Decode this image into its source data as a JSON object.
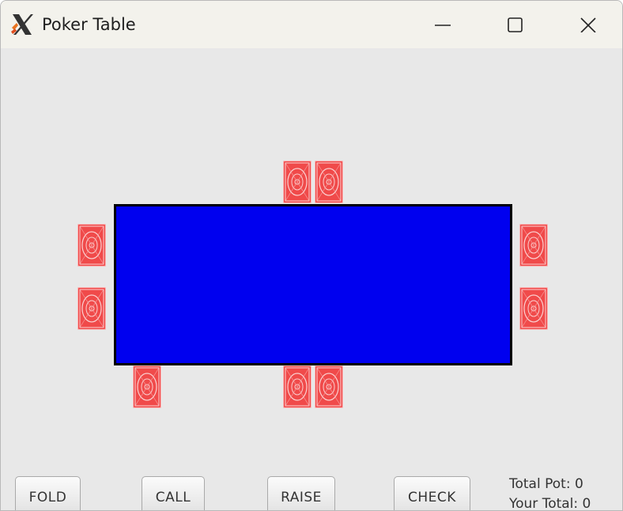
{
  "window": {
    "title": "Poker Table",
    "icons": {
      "app": "x-logo-icon",
      "minimize": "minimize-icon",
      "maximize": "maximize-icon",
      "close": "close-icon"
    }
  },
  "table": {
    "felt_color": "#0000ef",
    "border_color": "#000000"
  },
  "cards": {
    "back_color": "#f04a4a",
    "face": "card-back"
  },
  "actions": {
    "fold": "FOLD",
    "call": "CALL",
    "raise": "RAISE",
    "check": "CHECK"
  },
  "status": {
    "total_pot": "Total Pot: 0",
    "your_total": "Your Total: 0"
  }
}
